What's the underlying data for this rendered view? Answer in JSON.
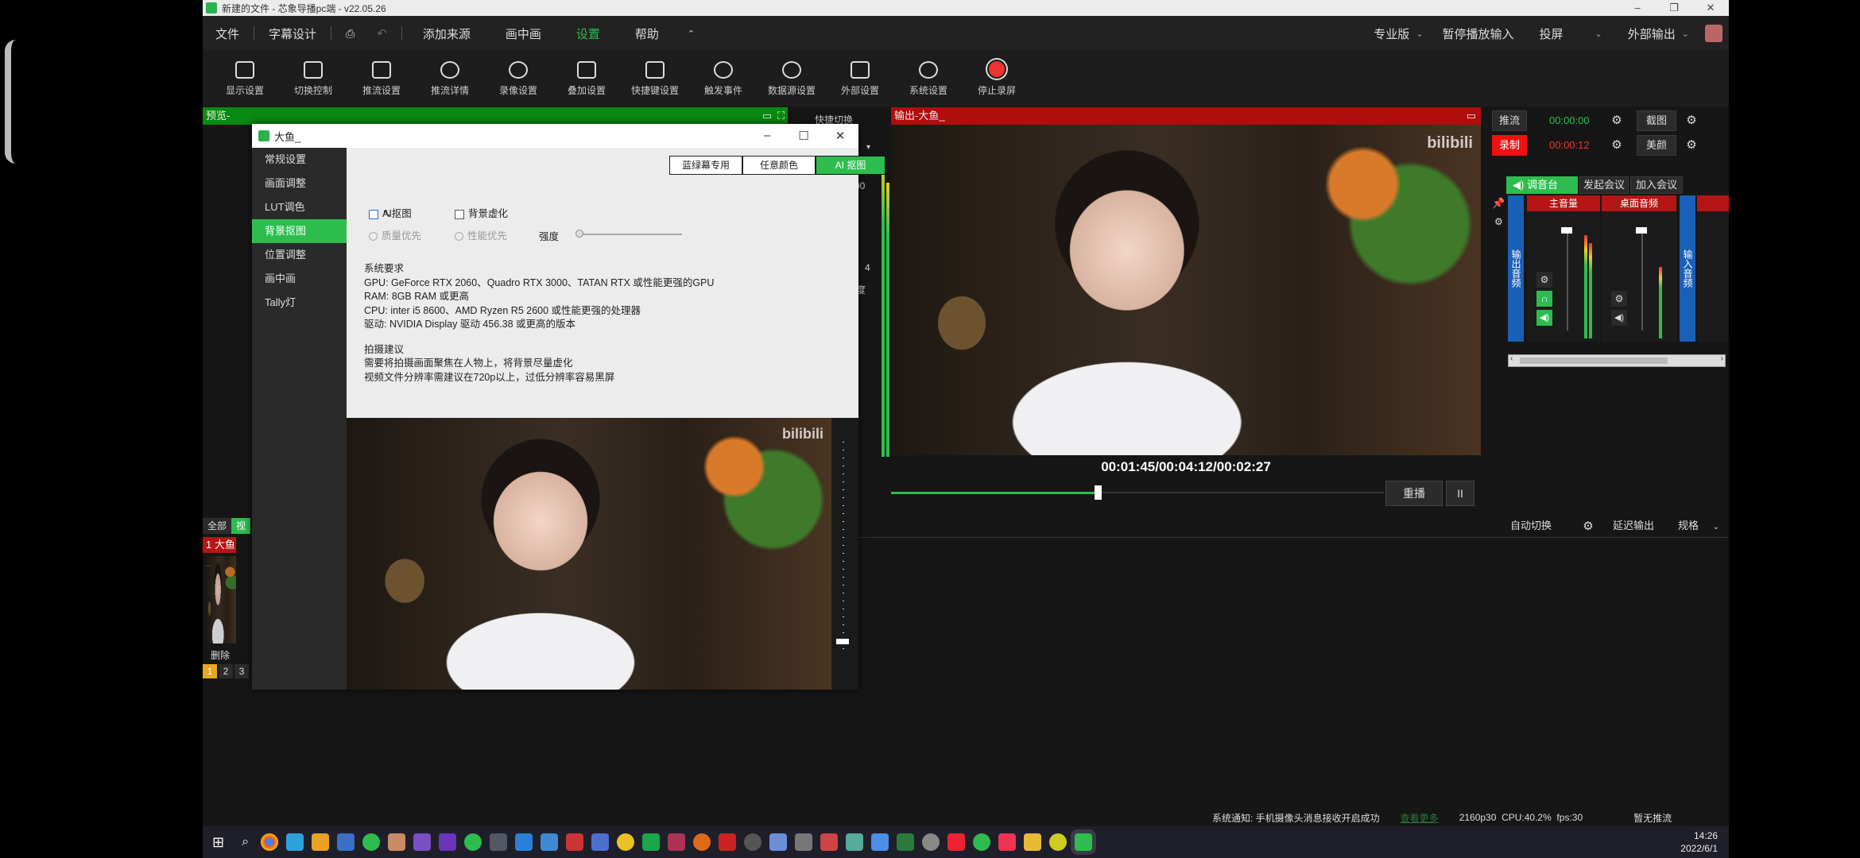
{
  "window": {
    "title": "新建的文件 - 芯象导播pc端 - v22.05.26"
  },
  "menu": {
    "items": [
      "文件",
      "字幕设计",
      "添加来源",
      "画中画",
      "设置",
      "帮助"
    ],
    "active": "设置",
    "right": {
      "edition": "专业版",
      "pause_input": "暂停播放输入",
      "cast": "投屏",
      "ext_out": "外部输出"
    }
  },
  "toolbar": [
    "显示设置",
    "切换控制",
    "推流设置",
    "推流详情",
    "录像设置",
    "叠加设置",
    "快捷键设置",
    "触发事件",
    "数据源设置",
    "外部设置",
    "系统设置",
    "停止录屏"
  ],
  "preview": {
    "label": "预览-"
  },
  "output": {
    "label": "输出-大鱼_",
    "watermark": "bilibili",
    "time": "00:01:45/00:04:12/00:02:27",
    "progress": 0.42,
    "replay": "重播",
    "pause": "II"
  },
  "behind": {
    "quick_switch": "快捷切换",
    "num_4": "4",
    "frag_00": "00",
    "frag_du": "度"
  },
  "right_panel": {
    "stream": "推流",
    "stream_time": "00:00:00",
    "record": "录制",
    "record_time": "00:00:12",
    "screenshot": "截图",
    "beauty": "美颜",
    "mixer_tab": "调音台",
    "meeting": "发起会议",
    "join": "加入会议",
    "ch1": "主音量",
    "ch2": "桌面音频",
    "out_audio": "输出音频",
    "in_audio": "输入音频",
    "auto_switch": "自动切换",
    "delay": "延迟输出",
    "spec": "规格"
  },
  "scenes": {
    "tab_all": "全部",
    "tab_video": "视",
    "scene1": "1 大鱼_",
    "delete": "删除",
    "pages": [
      "1",
      "2",
      "3"
    ]
  },
  "status": {
    "notice": "系统通知: 手机摄像头消息接收开启成功",
    "view": "查看更多",
    "info": "2160p30  CPU:40.2%  fps:30",
    "stream_state": "暂无推流"
  },
  "clock": {
    "time": "14:26",
    "date": "2022/6/1"
  },
  "dialog": {
    "title": "大鱼_",
    "nav": [
      "常规设置",
      "画面调整",
      "LUT调色",
      "背景抠图",
      "位置调整",
      "画中画",
      "Tally灯"
    ],
    "active_nav": "背景抠图",
    "tabs": [
      "蓝绿幕专用",
      "任意颜色",
      "AI 抠图"
    ],
    "active_tab": "AI 抠图",
    "opt_ai": "AI抠图",
    "opt_blur": "背景虚化",
    "quality": "质量优先",
    "perf": "性能优先",
    "strength": "强度",
    "req_title": "系统要求",
    "req_lines": [
      "GPU: GeForce RTX 2060、Quadro RTX 3000、TATAN RTX 或性能更强的GPU",
      "RAM: 8GB RAM 或更高",
      "CPU: inter i5 8600、AMD Ryzen R5 2600 或性能更强的处理器",
      "驱动: NVIDIA Display 驱动 456.38 或更高的版本"
    ],
    "tip_title": "拍摄建议",
    "tip_lines": [
      "需要将拍摄画面聚焦在人物上，将背景尽量虚化",
      "视频文件分辨率需建议在720p以上，过低分辨率容易黑屏"
    ],
    "watermark": "bilibili"
  }
}
